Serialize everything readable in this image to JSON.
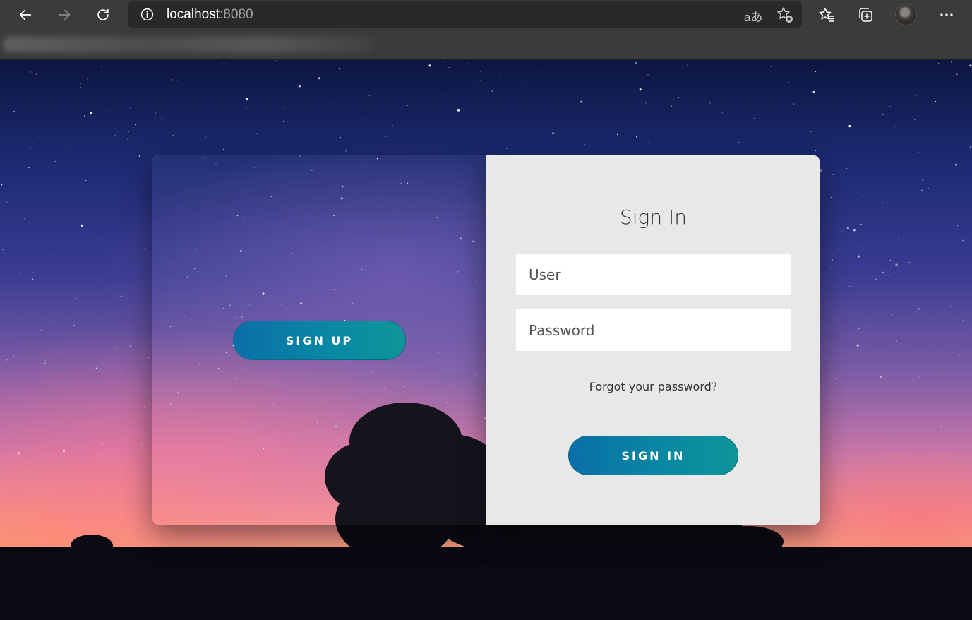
{
  "browser": {
    "url_host": "localhost",
    "url_port": ":8080",
    "read_aloud_glyph": "aあ",
    "icons": [
      "back-icon",
      "forward-icon",
      "refresh-icon",
      "info-icon",
      "read-aloud-icon",
      "add-favorite-icon",
      "favorites-icon",
      "collections-icon",
      "profile-avatar",
      "more-icon"
    ]
  },
  "signup_panel": {
    "button_label": "SIGN UP"
  },
  "signin_panel": {
    "title": "Sign In",
    "user_placeholder": "User",
    "password_placeholder": "Password",
    "forgot_label": "Forgot your password?",
    "button_label": "SIGN IN"
  },
  "colors": {
    "button_gradient_start": "#0a6fa8",
    "button_gradient_end": "#0c9699",
    "panel_background": "#e8e8e8",
    "chrome_background": "#3b3b3b"
  }
}
